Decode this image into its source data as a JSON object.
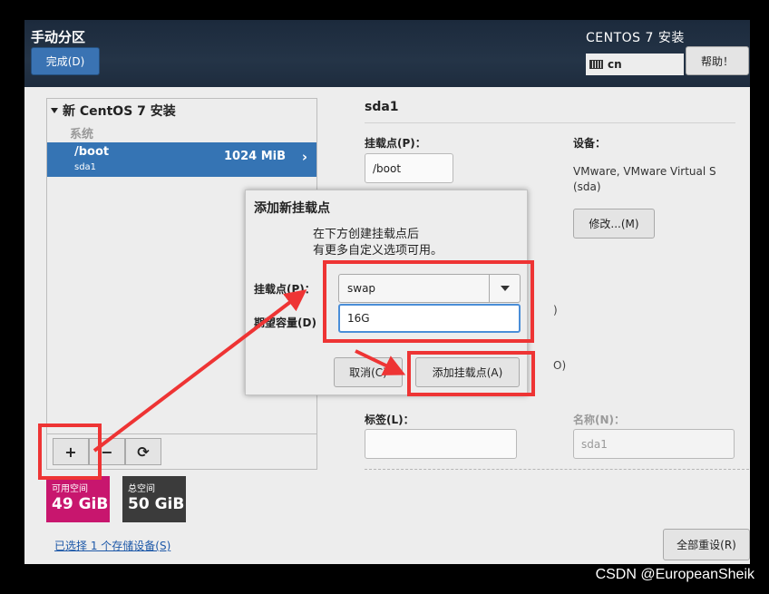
{
  "header": {
    "title": "手动分区",
    "done_button": "完成(D)",
    "product": "CENTOS 7 安装",
    "keyboard_layout": "cn",
    "help_button": "帮助！"
  },
  "left_panel": {
    "tree_title": "新 CentOS 7 安装",
    "section_label": "系统",
    "partition": {
      "mount": "/boot",
      "device": "sda1",
      "size": "1024 MiB"
    },
    "toolbar": {
      "add": "+",
      "remove": "−",
      "refresh": "⟳"
    },
    "available_space": {
      "label": "可用空间",
      "value": "49 GiB",
      "color": "#c8166e"
    },
    "total_space": {
      "label": "总空间",
      "value": "50 GiB",
      "color": "#3b3b3b"
    },
    "storage_link": "已选择 1 个存储设备(S)"
  },
  "details": {
    "heading": "sda1",
    "mount_point_label": "挂载点(P)：",
    "mount_point_value": "/boot",
    "device_label": "设备：",
    "device_text_line1": "VMware, VMware Virtual S",
    "device_text_line2": "(sda)",
    "modify_button": "修改...(M)",
    "label_label": "标签(L)：",
    "label_value": "",
    "name_label": "名称(N)：",
    "name_value": "sda1",
    "reset_button": "全部重设(R)",
    "partial_text_1": ")",
    "partial_text_2": "O)"
  },
  "dialog": {
    "title": "添加新挂载点",
    "description_line1": "在下方创建挂载点后",
    "description_line2": "有更多自定义选项可用。",
    "mount_point_label": "挂载点(P)：",
    "mount_point_value": "swap",
    "capacity_label": "期望容量(D)",
    "capacity_value": "16G",
    "cancel_button": "取消(C)",
    "add_button": "添加挂载点(A)"
  },
  "annotation_color": "#ee3434",
  "watermark": "CSDN @EuropeanSheik"
}
